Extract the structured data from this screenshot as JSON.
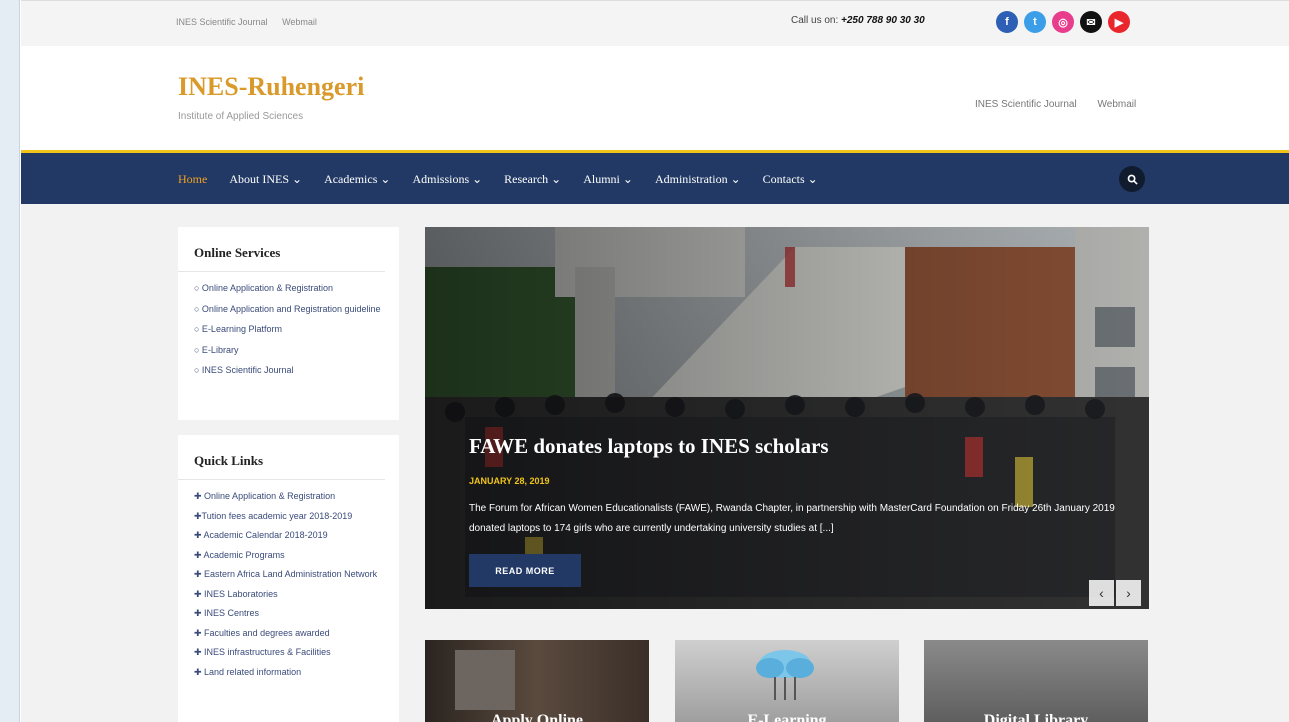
{
  "topbar": {
    "links": [
      "INES Scientific Journal",
      "Webmail"
    ],
    "phone_label": "Call us on:",
    "phone_number": "+250 788 90 30 30",
    "socials": [
      {
        "icon": "facebook-icon",
        "color": "#2d5fb5",
        "glyph": "f"
      },
      {
        "icon": "twitter-icon",
        "color": "#3c9ee8",
        "glyph": "t"
      },
      {
        "icon": "instagram-icon",
        "color": "#e83c8c",
        "glyph": "◎"
      },
      {
        "icon": "email-icon",
        "color": "#111111",
        "glyph": "✉"
      },
      {
        "icon": "youtube-icon",
        "color": "#e8262b",
        "glyph": "▶"
      }
    ]
  },
  "header": {
    "brand": "INES-Ruhengeri",
    "tagline": "Institute of Applied Sciences",
    "links": [
      "INES Scientific Journal",
      "Webmail"
    ]
  },
  "nav": {
    "items": [
      "Home",
      "About INES ⌄",
      "Academics ⌄",
      "Admissions ⌄",
      "Research ⌄",
      "Alumni ⌄",
      "Administration ⌄",
      "Contacts ⌄"
    ],
    "active_index": 0
  },
  "online_services": {
    "title": "Online Services",
    "items": [
      "○ Online Application & Registration",
      "○ Online Application and Registration guideline",
      "○ E-Learning Platform",
      "○ E-Library",
      "○ INES Scientific Journal"
    ]
  },
  "quick_links": {
    "title": "Quick Links",
    "items": [
      "✚ Online Application & Registration",
      "✚Tution fees academic year 2018-2019",
      "✚ Academic Calendar 2018-2019",
      "✚ Academic Programs",
      "✚ Eastern Africa Land Administration Network",
      "✚ INES Laboratories",
      "✚ INES Centres",
      "✚ Faculties and degrees awarded",
      "✚ INES infrastructures & Facilities",
      "✚ Land related information"
    ]
  },
  "slider": {
    "title": "FAWE donates laptops to INES scholars",
    "date": "JANUARY 28, 2019",
    "excerpt": "The Forum for African Women Educationalists (FAWE), Rwanda Chapter, in partnership with MasterCard Foundation on Friday 26th January 2019 donated laptops to 174 girls who are currently undertaking university studies at [...]",
    "button": "READ MORE",
    "prev": "‹",
    "next": "›"
  },
  "cards": [
    {
      "title": "Apply Online"
    },
    {
      "title": "E-Learning"
    },
    {
      "title": "Digital Library"
    }
  ]
}
